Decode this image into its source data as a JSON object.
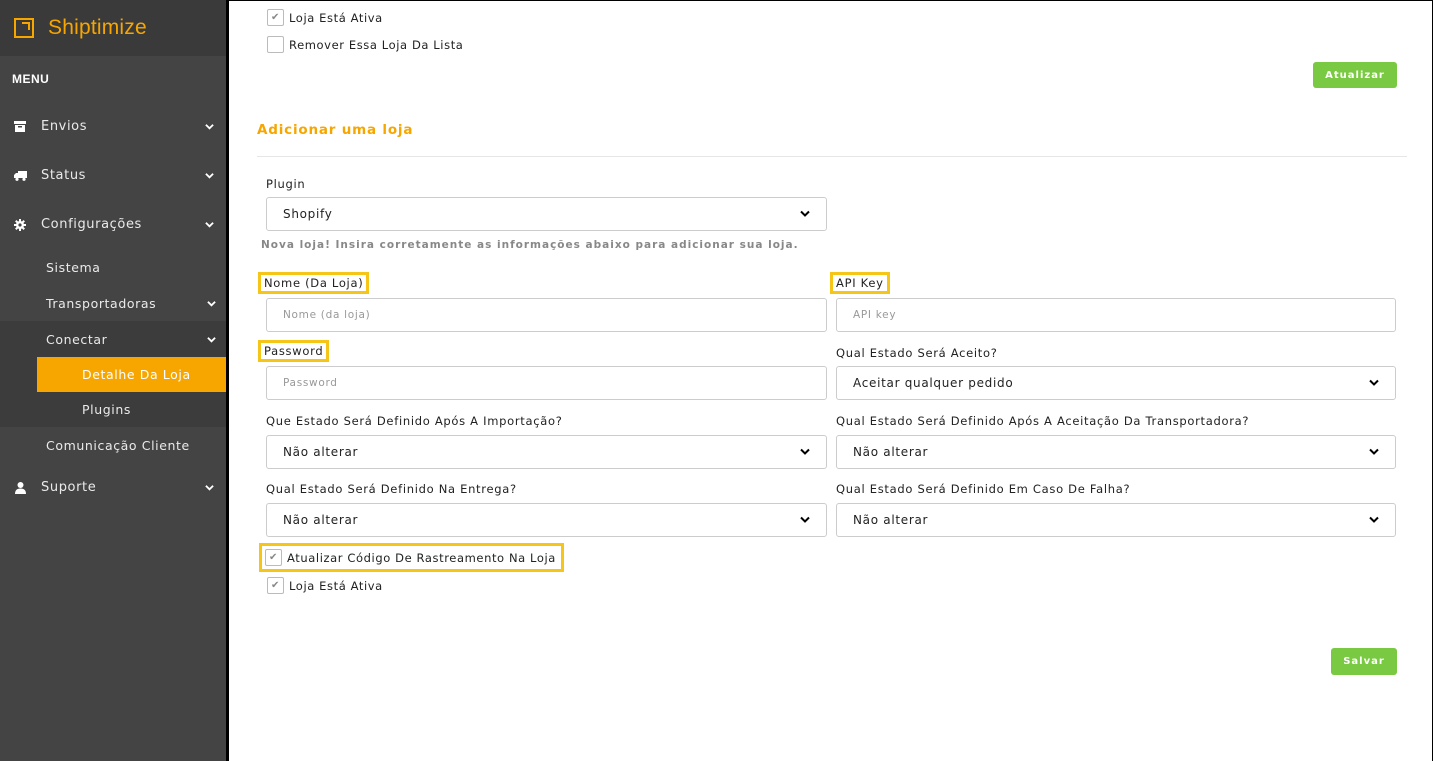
{
  "sidebar": {
    "brand": "Shiptimize",
    "menu_label": "MENU",
    "items": [
      {
        "label": "Envios",
        "icon": "archive-icon"
      },
      {
        "label": "Status",
        "icon": "truck-icon"
      },
      {
        "label": "Configurações",
        "icon": "gear-icon"
      }
    ],
    "config_sub": {
      "sistema": "Sistema",
      "transportadoras": "Transportadoras",
      "conectar": "Conectar",
      "detalhe_loja": "Detalhe Da Loja",
      "plugins": "Plugins",
      "comunicacao": "Comunicação Cliente"
    },
    "suporte": {
      "label": "Suporte",
      "icon": "user-icon"
    }
  },
  "top_store": {
    "active_label": "Loja Está Ativa",
    "remove_label": "Remover Essa Loja Da Lista",
    "update_button": "Atualizar"
  },
  "add_store": {
    "title": "Adicionar uma loja",
    "plugin_label": "Plugin",
    "plugin_value": "Shopify",
    "hint": "Nova loja! Insira corretamente as informações abaixo para adicionar sua loja.",
    "name_label": "Nome (Da Loja)",
    "name_placeholder": "Nome (da loja)",
    "apikey_label": "API Key",
    "apikey_placeholder": "API key",
    "password_label": "Password",
    "password_placeholder": "Password",
    "accepted_state_label": "Qual Estado Será Aceito?",
    "accepted_state_value": "Aceitar qualquer pedido",
    "after_import_label": "Que Estado Será Definido Após A Importação?",
    "after_import_value": "Não alterar",
    "after_carrier_label": "Qual Estado Será Definido Após A Aceitação Da Transportadora?",
    "after_carrier_value": "Não alterar",
    "on_delivery_label": "Qual Estado Será Definido Na Entrega?",
    "on_delivery_value": "Não alterar",
    "on_failure_label": "Qual Estado Será Definido Em Caso De Falha?",
    "on_failure_value": "Não alterar",
    "update_tracking_label": "Atualizar Código De Rastreamento Na Loja",
    "active_label": "Loja Está Ativa",
    "save_button": "Salvar"
  },
  "colors": {
    "accent": "#f7a600",
    "button": "#7ac943",
    "sidebar": "#444444",
    "highlight": "#f5c518"
  }
}
